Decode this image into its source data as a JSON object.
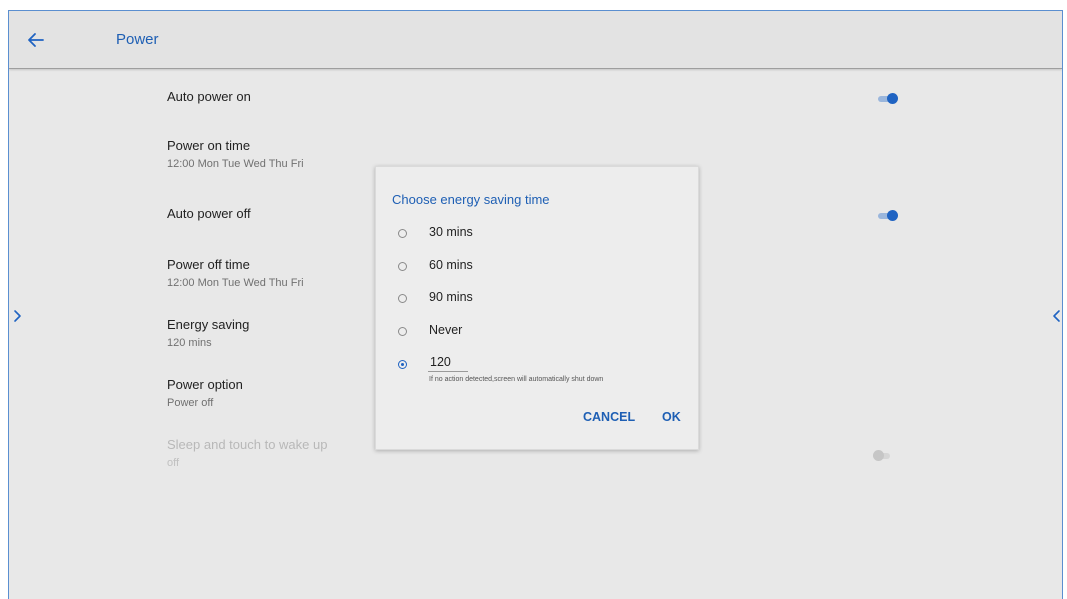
{
  "header": {
    "title": "Power"
  },
  "settings": {
    "auto_power_on": {
      "title": "Auto power on",
      "enabled": true
    },
    "power_on_time": {
      "title": "Power on time",
      "subtitle": "12:00 Mon Tue Wed Thu Fri"
    },
    "auto_power_off": {
      "title": "Auto power off",
      "enabled": true
    },
    "power_off_time": {
      "title": "Power off time",
      "subtitle": "12:00 Mon Tue Wed Thu Fri"
    },
    "energy_saving": {
      "title": "Energy saving",
      "subtitle": "120 mins"
    },
    "power_option": {
      "title": "Power option",
      "subtitle": "Power off"
    },
    "sleep_touch_wake": {
      "title": "Sleep and touch to wake up",
      "subtitle": "off",
      "enabled": false
    }
  },
  "dialog": {
    "title": "Choose energy saving time",
    "options": [
      {
        "label": "30 mins",
        "selected": false
      },
      {
        "label": "60 mins",
        "selected": false
      },
      {
        "label": "90 mins",
        "selected": false
      },
      {
        "label": "Never",
        "selected": false
      }
    ],
    "custom": {
      "value": "120",
      "selected": true
    },
    "hint": "If no action detected,screen will automatically shut down",
    "cancel_label": "CANCEL",
    "ok_label": "OK"
  },
  "icons": {
    "back": "arrow-left-icon",
    "left_nav": "chevron-right-icon",
    "right_nav": "chevron-left-icon"
  },
  "colors": {
    "accent": "#1f63c2",
    "header_bg": "#e3e3e3",
    "page_bg": "#e8e8e8",
    "dialog_bg": "#ededed",
    "toggle_off": "#c6c6c6"
  }
}
